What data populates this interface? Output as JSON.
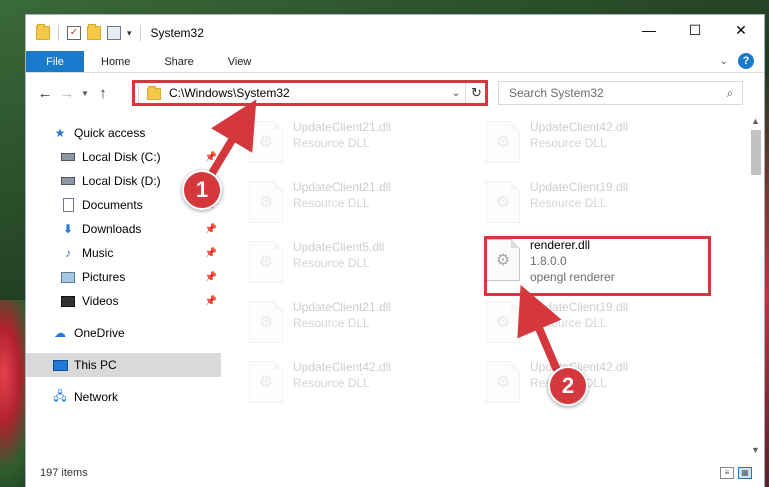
{
  "window": {
    "title": "System32",
    "controls": {
      "minimize": "—",
      "maximize": "☐",
      "close": "✕"
    }
  },
  "ribbon": {
    "tabs": [
      "File",
      "Home",
      "Share",
      "View"
    ],
    "help": "?"
  },
  "navigation": {
    "address": "C:\\Windows\\System32",
    "search_placeholder": "Search System32"
  },
  "sidebar": {
    "quick_access": "Quick access",
    "items": [
      {
        "label": "Local Disk (C:)",
        "icon": "disk-icon",
        "pinned": true
      },
      {
        "label": "Local Disk (D:)",
        "icon": "disk-icon",
        "pinned": false
      },
      {
        "label": "Documents",
        "icon": "documents-icon",
        "pinned": true
      },
      {
        "label": "Downloads",
        "icon": "downloads-icon",
        "pinned": true
      },
      {
        "label": "Music",
        "icon": "music-icon",
        "pinned": true
      },
      {
        "label": "Pictures",
        "icon": "pictures-icon",
        "pinned": true
      },
      {
        "label": "Videos",
        "icon": "videos-icon",
        "pinned": true
      }
    ],
    "onedrive": "OneDrive",
    "this_pc": "This PC",
    "network": "Network"
  },
  "files": [
    {
      "name": "UpdateClient21.dll",
      "desc": "Resource DLL",
      "faded": true
    },
    {
      "name": "UpdateClient42.dll",
      "desc": "Resource DLL",
      "faded": true
    },
    {
      "name": "UpdateClient21.dll",
      "desc": "Resource DLL",
      "faded": true
    },
    {
      "name": "UpdateClient19.dll",
      "desc": "Resource DLL",
      "faded": true
    },
    {
      "name": "UpdateClient5.dll",
      "desc": "Resource DLL",
      "faded": true
    },
    {
      "name": "renderer.dll",
      "version": "1.8.0.0",
      "desc": "opengl renderer",
      "faded": false
    },
    {
      "name": "UpdateClient21.dll",
      "desc": "Resource DLL",
      "faded": true
    },
    {
      "name": "UpdateClient19.dll",
      "desc": "Resource DLL",
      "faded": true
    },
    {
      "name": "UpdateClient42.dll",
      "desc": "Resource DLL",
      "faded": true
    },
    {
      "name": "UpdateClient42.dll",
      "desc": "Resource DLL",
      "faded": true
    }
  ],
  "status": {
    "item_count": "197 items"
  },
  "annotations": {
    "step1": "1",
    "step2": "2",
    "highlight_color": "#d4373c"
  }
}
